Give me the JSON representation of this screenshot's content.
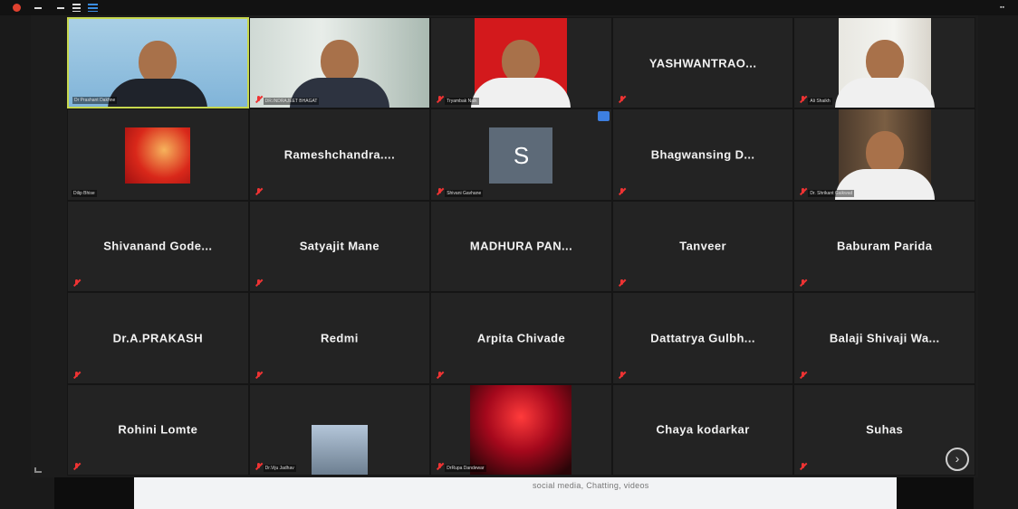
{
  "gallery": {
    "tiles": [
      {
        "name": "",
        "label": "Dr Prashant Dakhne",
        "muted": false,
        "kind": "photo-sky",
        "active": true
      },
      {
        "name": "",
        "label": "DR.INDRAJEET BHAGAT",
        "muted": true,
        "kind": "photo-office"
      },
      {
        "name": "",
        "label": "Tryambak Naik",
        "muted": true,
        "kind": "photo-red"
      },
      {
        "name": "YASHWANTRAO...",
        "label": "",
        "muted": true,
        "kind": "name"
      },
      {
        "name": "",
        "label": "Ali Shaikh",
        "muted": true,
        "kind": "photo-room"
      },
      {
        "name": "",
        "label": "Dilip Bhise",
        "muted": false,
        "kind": "photo-orange"
      },
      {
        "name": "Rameshchandra....",
        "label": "",
        "muted": true,
        "kind": "name"
      },
      {
        "name": "",
        "label": "Shivani Gavhane",
        "muted": true,
        "kind": "avatar",
        "avatar_letter": "S",
        "badge": true
      },
      {
        "name": "Bhagwansing D...",
        "label": "",
        "muted": true,
        "kind": "name"
      },
      {
        "name": "",
        "label": "Dr. Shrikant Gaikwad",
        "muted": true,
        "kind": "photo-shelf"
      },
      {
        "name": "Shivanand Gode...",
        "label": "",
        "muted": true,
        "kind": "name"
      },
      {
        "name": "Satyajit Mane",
        "label": "",
        "muted": true,
        "kind": "name"
      },
      {
        "name": "MADHURA PAN...",
        "label": "",
        "muted": false,
        "kind": "name"
      },
      {
        "name": "Tanveer",
        "label": "",
        "muted": true,
        "kind": "name"
      },
      {
        "name": "Baburam Parida",
        "label": "",
        "muted": true,
        "kind": "name"
      },
      {
        "name": "Dr.A.PRAKASH",
        "label": "",
        "muted": true,
        "kind": "name"
      },
      {
        "name": "Redmi",
        "label": "",
        "muted": true,
        "kind": "name"
      },
      {
        "name": "Arpita Chivade",
        "label": "",
        "muted": true,
        "kind": "name"
      },
      {
        "name": "Dattatrya Gulbh...",
        "label": "",
        "muted": true,
        "kind": "name"
      },
      {
        "name": "Balaji Shivaji Wa...",
        "label": "",
        "muted": true,
        "kind": "name"
      },
      {
        "name": "Rohini Lomte",
        "label": "",
        "muted": true,
        "kind": "name"
      },
      {
        "name": "",
        "label": "Dr.Viju Jadhav",
        "muted": true,
        "kind": "photo-small"
      },
      {
        "name": "",
        "label": "DrRupa Dandewar",
        "muted": true,
        "kind": "photo-heart"
      },
      {
        "name": "Chaya kodarkar",
        "label": "",
        "muted": false,
        "kind": "name"
      },
      {
        "name": "Suhas",
        "label": "",
        "muted": true,
        "kind": "name"
      }
    ]
  },
  "share": {
    "text": "social media, Chatting, videos"
  },
  "controls": {
    "next_page": "›"
  },
  "colors": {
    "active_border": "#c7d84e",
    "muted_icon": "#e33333",
    "tile_bg": "#232323"
  }
}
